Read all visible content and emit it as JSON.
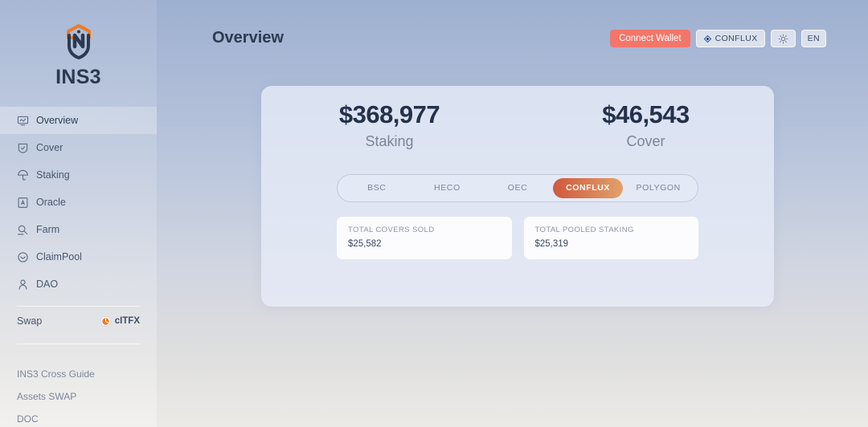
{
  "brand": {
    "name": "INS3",
    "logo_icon": "shield-logo-icon"
  },
  "sidebar": {
    "items": [
      {
        "label": "Overview",
        "icon": "chart-monitor-icon",
        "active": true
      },
      {
        "label": "Cover",
        "icon": "shield-check-icon",
        "active": false
      },
      {
        "label": "Staking",
        "icon": "umbrella-icon",
        "active": false
      },
      {
        "label": "Oracle",
        "icon": "id-card-icon",
        "active": false
      },
      {
        "label": "Farm",
        "icon": "magnifier-icon",
        "active": false
      },
      {
        "label": "ClaimPool",
        "icon": "smiley-circle-icon",
        "active": false
      },
      {
        "label": "DAO",
        "icon": "person-icon",
        "active": false
      }
    ],
    "swap": {
      "label": "Swap",
      "token": "cITFX",
      "token_icon": "token-circle-icon"
    },
    "links": [
      {
        "label": "INS3 Cross Guide"
      },
      {
        "label": "Assets SWAP"
      },
      {
        "label": "DOC"
      }
    ]
  },
  "header": {
    "title": "Overview",
    "connect_wallet_label": "Connect Wallet",
    "network_label": "CONFLUX",
    "network_icon": "conflux-diamond-icon",
    "theme_icon": "sun-icon",
    "language_label": "EN"
  },
  "overview": {
    "totals": [
      {
        "amount": "$368,977",
        "label": "Staking"
      },
      {
        "amount": "$46,543",
        "label": "Cover"
      }
    ],
    "networks": [
      {
        "label": "BSC",
        "active": false
      },
      {
        "label": "HECO",
        "active": false
      },
      {
        "label": "OEC",
        "active": false
      },
      {
        "label": "CONFLUX",
        "active": true
      },
      {
        "label": "POLYGON",
        "active": false
      }
    ],
    "stats": [
      {
        "title": "TOTAL COVERS SOLD",
        "value": "$25,582"
      },
      {
        "title": "TOTAL POOLED STAKING",
        "value": "$25,319"
      }
    ]
  },
  "colors": {
    "accent_coral": "#f3766a",
    "accent_orange_start": "#d1573c",
    "accent_orange_end": "#e2a16b",
    "logo_orange": "#f07b23",
    "text_dark": "#23314a",
    "text_muted": "#7b8699"
  }
}
